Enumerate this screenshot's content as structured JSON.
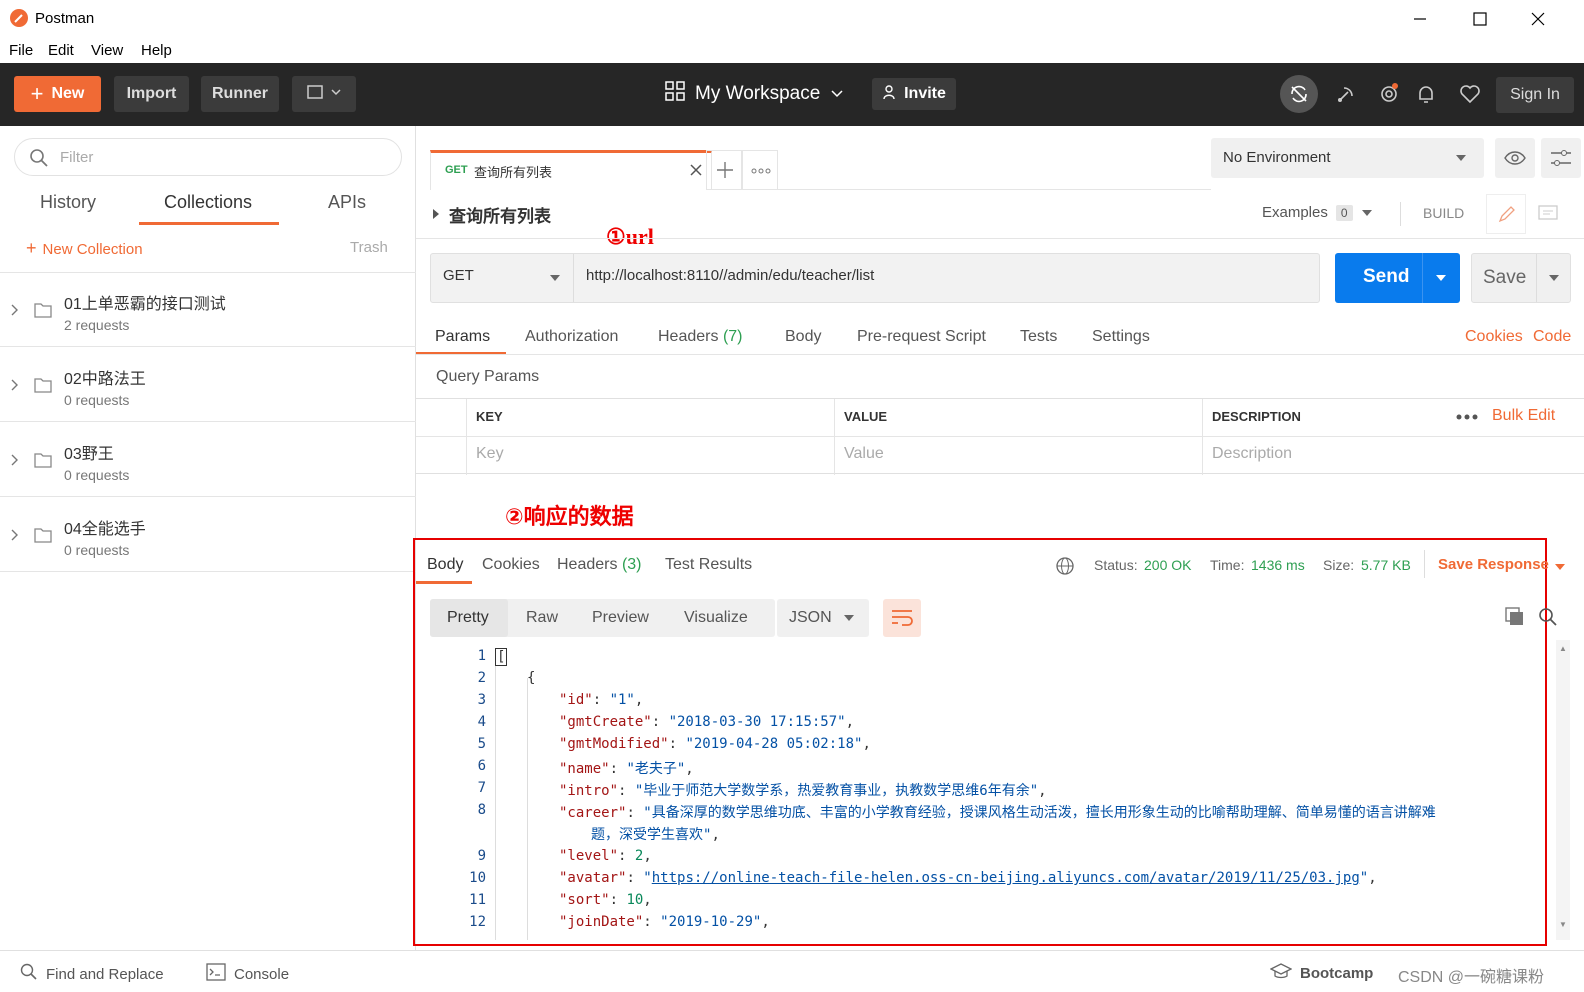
{
  "window": {
    "title": "Postman"
  },
  "menu": [
    "File",
    "Edit",
    "View",
    "Help"
  ],
  "toolbar": {
    "new_label": "New",
    "import_label": "Import",
    "runner_label": "Runner",
    "workspace_label": "My Workspace",
    "invite_label": "Invite",
    "signin_label": "Sign In",
    "accent": "#f06a35"
  },
  "sidebar": {
    "filter_placeholder": "Filter",
    "tabs": [
      "History",
      "Collections",
      "APIs"
    ],
    "active_tab": "Collections",
    "new_collection": "New Collection",
    "trash": "Trash",
    "collections": [
      {
        "name": "01上单恶霸的接口测试",
        "requests": "2 requests"
      },
      {
        "name": "02中路法王",
        "requests": "0 requests"
      },
      {
        "name": "03野王",
        "requests": "0 requests"
      },
      {
        "name": "04全能选手",
        "requests": "0 requests"
      }
    ]
  },
  "request_tab": {
    "method": "GET",
    "title": "查询所有列表"
  },
  "environment": {
    "label": "No Environment"
  },
  "request": {
    "name": "查询所有列表",
    "annotation_url": "①url",
    "examples_label": "Examples",
    "examples_count": "0",
    "build_label": "BUILD",
    "method": "GET",
    "url": "http://localhost:8110//admin/edu/teacher/list",
    "send_label": "Send",
    "save_label": "Save",
    "tabs": [
      "Params",
      "Authorization",
      "Headers",
      "Body",
      "Pre-request Script",
      "Tests",
      "Settings"
    ],
    "headers_count": "(7)",
    "cookies_label": "Cookies",
    "code_label": "Code",
    "query_params_label": "Query Params",
    "columns": [
      "KEY",
      "VALUE",
      "DESCRIPTION"
    ],
    "placeholders": [
      "Key",
      "Value",
      "Description"
    ],
    "bulk_edit": "Bulk Edit"
  },
  "annotation_response": "②响应的数据",
  "response": {
    "tabs": [
      "Body",
      "Cookies",
      "Headers",
      "Test Results"
    ],
    "headers_count": "(3)",
    "status_label": "Status:",
    "status_value": "200 OK",
    "time_label": "Time:",
    "time_value": "1436 ms",
    "size_label": "Size:",
    "size_value": "5.77 KB",
    "save_response": "Save Response",
    "formats": [
      "Pretty",
      "Raw",
      "Preview",
      "Visualize"
    ],
    "lang": "JSON",
    "lines": [
      {
        "n": "1",
        "text": "["
      },
      {
        "n": "2",
        "text": "{"
      },
      {
        "n": "3",
        "key": "\"id\"",
        "val": "\"1\"",
        "type": "str"
      },
      {
        "n": "4",
        "key": "\"gmtCreate\"",
        "val": "\"2018-03-30 17:15:57\"",
        "type": "str"
      },
      {
        "n": "5",
        "key": "\"gmtModified\"",
        "val": "\"2019-04-28 05:02:18\"",
        "type": "str"
      },
      {
        "n": "6",
        "key": "\"name\"",
        "val": "\"老夫子\"",
        "type": "str"
      },
      {
        "n": "7",
        "key": "\"intro\"",
        "val": "\"毕业于师范大学数学系，热爱教育事业，执教数学思维6年有余\"",
        "type": "str"
      },
      {
        "n": "8",
        "key": "\"career\"",
        "val": "\"具备深厚的数学思维功底、丰富的小学教育经验，授课风格生动活泼，擅长用形象生动的比喻帮助理解、简单易懂的语言讲解难",
        "cont": "题，深受学生喜欢\"",
        "type": "str"
      },
      {
        "n": "9",
        "key": "\"level\"",
        "val": "2",
        "type": "num"
      },
      {
        "n": "10",
        "key": "\"avatar\"",
        "val": "https://online-teach-file-helen.oss-cn-beijing.aliyuncs.com/avatar/2019/11/25/03.jpg",
        "type": "link"
      },
      {
        "n": "11",
        "key": "\"sort\"",
        "val": "10",
        "type": "num"
      },
      {
        "n": "12",
        "key": "\"joinDate\"",
        "val": "\"2019-10-29\"",
        "type": "str"
      }
    ]
  },
  "statusbar": {
    "find_replace": "Find and Replace",
    "console": "Console",
    "bootcamp": "Bootcamp",
    "watermark": "CSDN @一碗糖课粉"
  }
}
